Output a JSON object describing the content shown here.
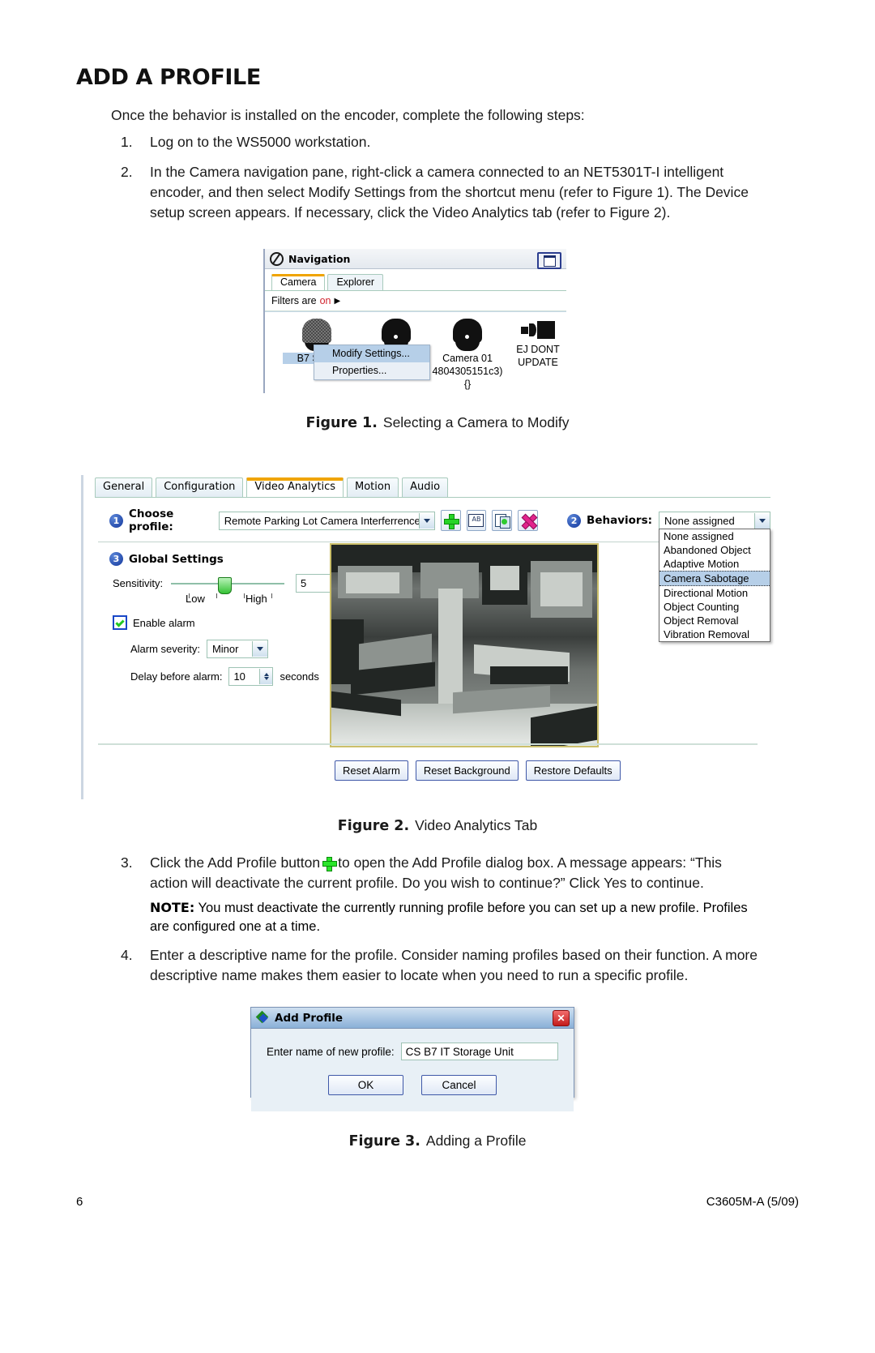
{
  "document": {
    "title": "ADD A PROFILE",
    "intro": "Once the behavior is installed on the encoder, complete the following steps:",
    "steps": [
      {
        "num": "1.",
        "text": "Log on to the WS5000 workstation."
      },
      {
        "num": "2.",
        "text": "In the Camera navigation pane, right-click a camera connected to an NET5301T-I intelligent encoder, and then select Modify Settings from the shortcut menu (refer to Figure 1). The Device setup screen appears. If necessary, click the Video Analytics tab (refer to Figure 2)."
      },
      {
        "num": "3.",
        "text_before_icon": "Click the Add Profile button",
        "text_after_icon": "to open the Add Profile dialog box. A message appears: “This action will deactivate the current profile. Do you wish to continue?” Click Yes to continue."
      },
      {
        "num": "4.",
        "text": "Enter a descriptive name for the profile. Consider naming profiles based on their function. A more descriptive name makes them easier to locate when you need to run a specific profile."
      }
    ],
    "note": {
      "label": "NOTE:",
      "text": "You must deactivate the currently running profile before you can set up a new profile. Profiles are configured one at a time."
    },
    "captions": {
      "fig1_label": "Figure 1.",
      "fig1_text": "Selecting a Camera to Modify",
      "fig2_label": "Figure 2.",
      "fig2_text": "Video Analytics Tab",
      "fig3_label": "Figure 3.",
      "fig3_text": "Adding a Profile"
    },
    "footer": {
      "page_number": "6",
      "doc_code": "C3605M-A  (5/09)"
    }
  },
  "figure1": {
    "window_title": "Navigation",
    "restore_icon": "restore-window-icon",
    "tabs": [
      {
        "label": "Camera",
        "active": true
      },
      {
        "label": "Explorer",
        "active": false
      }
    ],
    "filter_bar": {
      "prefix": "Filters are",
      "state": "on",
      "arrow": "▶",
      "state_color": "#d1242f"
    },
    "cameras": [
      {
        "label": "B7 Smar",
        "icon": "dome-camera-icon",
        "selected": true
      },
      {
        "label": "",
        "icon": "dome-camera-icon",
        "selected": false
      },
      {
        "label": "Camera 01",
        "sublabel": "4804305151c3)",
        "sublabel2": "{}",
        "icon": "dome-camera-icon",
        "selected": false
      },
      {
        "label": "EJ DONT",
        "sublabel": "UPDATE",
        "icon": "box-camera-icon",
        "selected": false
      }
    ],
    "context_menu": [
      {
        "label": "Modify Settings...",
        "highlighted": true
      },
      {
        "label": "Properties...",
        "highlighted": false
      }
    ]
  },
  "figure2": {
    "tabs": [
      {
        "label": "General",
        "active": false
      },
      {
        "label": "Configuration",
        "active": false
      },
      {
        "label": "Video Analytics",
        "active": true
      },
      {
        "label": "Motion",
        "active": false
      },
      {
        "label": "Audio",
        "active": false
      }
    ],
    "choose_profile": {
      "step": "1",
      "label": "Choose profile:",
      "value": "Remote Parking Lot Camera Interferrence",
      "buttons": [
        {
          "icon": "add-profile-plus-icon",
          "name": "add-profile-button"
        },
        {
          "icon": "rename-profile-ab-icon",
          "name": "rename-profile-button",
          "glyph": "AB"
        },
        {
          "icon": "copy-profile-icon",
          "name": "copy-profile-button"
        },
        {
          "icon": "delete-profile-x-icon",
          "name": "delete-profile-button"
        }
      ]
    },
    "behaviors": {
      "step": "2",
      "label": "Behaviors:",
      "value": "None assigned",
      "options": [
        {
          "label": "None assigned",
          "selected": false
        },
        {
          "label": "Abandoned Object",
          "selected": false
        },
        {
          "label": "Adaptive Motion",
          "selected": false
        },
        {
          "label": "Camera Sabotage",
          "selected": true
        },
        {
          "label": "Directional Motion",
          "selected": false
        },
        {
          "label": "Object Counting",
          "selected": false
        },
        {
          "label": "Object Removal",
          "selected": false
        },
        {
          "label": "Vibration Removal",
          "selected": false
        }
      ]
    },
    "global_settings": {
      "step": "3",
      "title": "Global Settings",
      "sensitivity": {
        "label": "Sensitivity:",
        "value": "5",
        "low_label": "Low",
        "high_label": "High"
      },
      "enable_alarm": {
        "label": "Enable alarm",
        "checked": true
      },
      "alarm_severity": {
        "label": "Alarm severity:",
        "value": "Minor"
      },
      "delay_before_alarm": {
        "label": "Delay before alarm:",
        "value": "10",
        "unit": "seconds"
      }
    },
    "bottom_buttons": [
      {
        "label": "Reset Alarm"
      },
      {
        "label": "Reset Background"
      },
      {
        "label": "Restore Defaults"
      }
    ],
    "video_preview": {
      "name": "video-preview-pane"
    }
  },
  "figure3": {
    "title": "Add Profile",
    "close_icon": "close-icon",
    "field_label": "Enter name of new profile:",
    "field_value": "CS B7 IT Storage Unit",
    "ok_label": "OK",
    "cancel_label": "Cancel"
  }
}
